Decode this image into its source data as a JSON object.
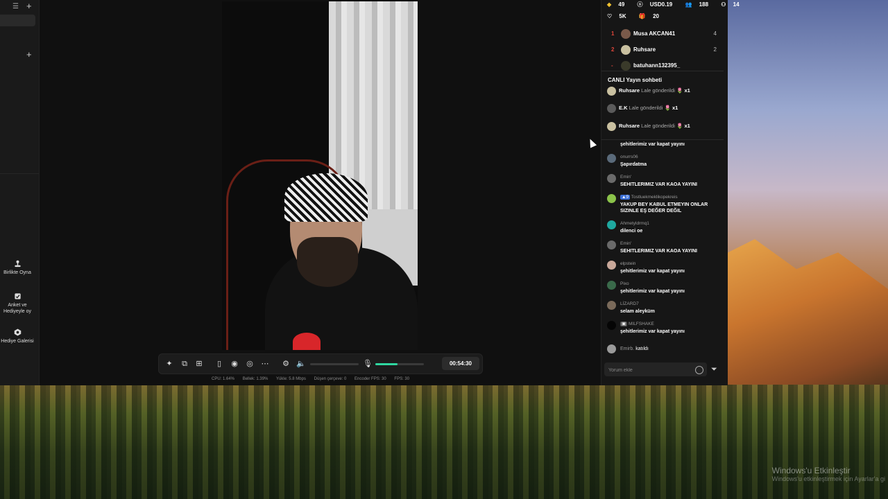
{
  "sidebar": {
    "buttons": [
      {
        "label": "Birlikte Oyna"
      },
      {
        "label": "Anket ve Hediyeyle oy"
      },
      {
        "label": "Hediye Galerisi"
      }
    ]
  },
  "stream": {
    "timer": "00:54:30",
    "mic_level": 0.45,
    "stats": {
      "cpu": "CPU: 1.64%",
      "memory": "Bellek: 1.39%",
      "upload": "Yükle: 5.8 Mbps",
      "dropped": "Düşen çerçeve: 0",
      "encoder_fps": "Encoder FPS: 30",
      "fps": "FPS: 30"
    }
  },
  "panel": {
    "stats_row1": [
      "49",
      "USD0.19",
      "188",
      "14"
    ],
    "stats_row2": [
      "5K",
      "20"
    ],
    "leaderboard": [
      {
        "rank": "1",
        "name": "Musa AKCAN41",
        "score": "4"
      },
      {
        "rank": "2",
        "name": "Ruhsare",
        "score": "2"
      },
      {
        "rank": "-",
        "name": "batuhann132395_",
        "score": ""
      }
    ],
    "chat_title": "CANLI Yayın sohbeti",
    "gifts": [
      {
        "name": "Ruhsare",
        "text": "Lale gönderildi",
        "count": "x1"
      },
      {
        "name": "E.K",
        "text": "Lale gönderildi",
        "count": "x1"
      },
      {
        "name": "Ruhsare",
        "text": "Lale gönderildi",
        "count": "x1"
      }
    ],
    "messages": [
      {
        "name": "",
        "text": "şehitlerimiz var kapat yayını"
      },
      {
        "name": "onurrs06",
        "text": "Şapırdatma"
      },
      {
        "name": "Emin'",
        "text": "SEHITLERIMIZ VAR KAOA YAYINI"
      },
      {
        "name": "Tostluekmeklikopekreis",
        "text": "YAKUP BEY KABUL ETMEYIN ONLAR SIZINLE EŞ DEĞER DEĞIL"
      },
      {
        "name": "Ahmetyldrmq1",
        "text": "dilenci oe"
      },
      {
        "name": "Emin'",
        "text": "SEHITLERIMIZ VAR KAOA YAYINI"
      },
      {
        "name": "elpstein",
        "text": "şehitlerimiz var kapat yayını"
      },
      {
        "name": "Pixo",
        "text": "şehitlerimiz var kapat yayını"
      },
      {
        "name": "LİZARD7",
        "text": "selam aleyküm"
      },
      {
        "name": "MILFSHAKE",
        "text": "şehitlerimiz var kapat yayını"
      },
      {
        "name": "Emirb.",
        "text": "katıldı"
      }
    ],
    "input_placeholder": "Yorum ekle"
  },
  "desktop": {
    "activate_title": "Windows'u Etkinleştir",
    "activate_sub": "Windows'u etkinleştirmek için Ayarlar'a gi"
  },
  "colors": {
    "accent": "#2fd6a0",
    "rank": "#e0463a"
  }
}
